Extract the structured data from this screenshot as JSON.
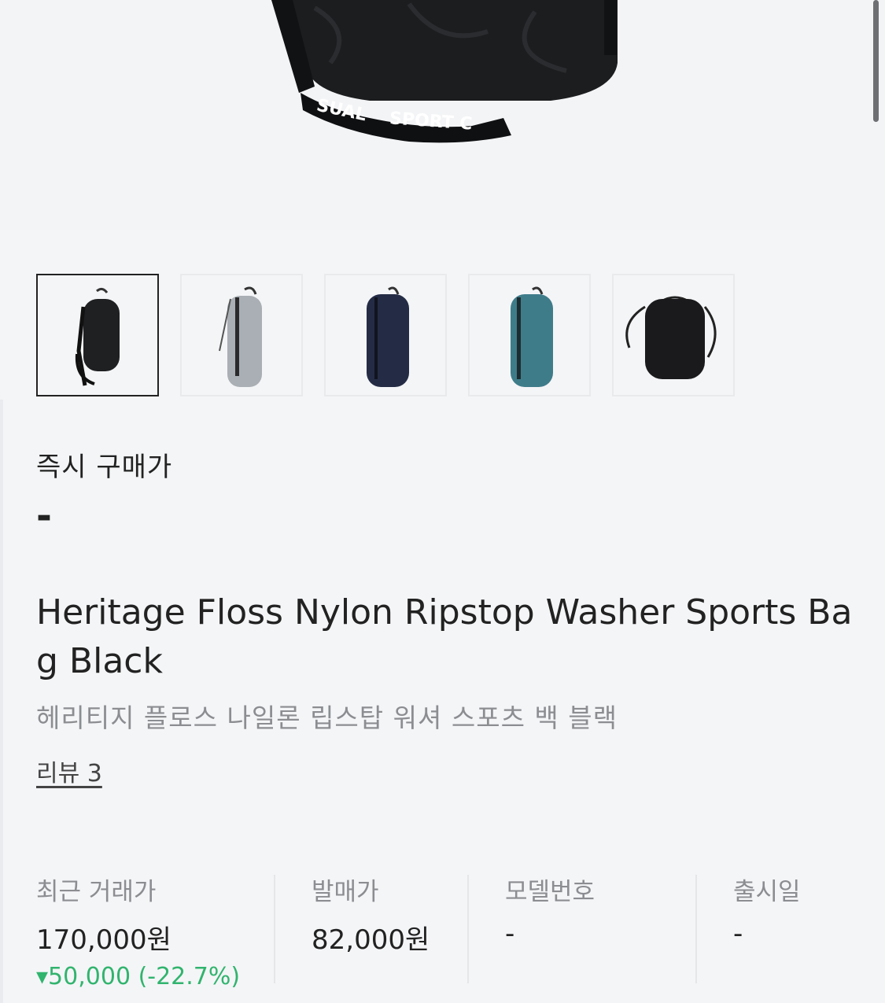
{
  "hero": {
    "image": "product-bag-black-closeup",
    "strap_text_left": "SUAL",
    "strap_text_right": "SPORT C"
  },
  "thumbnails": [
    {
      "color": "#1f2022",
      "selected": true,
      "name": "black"
    },
    {
      "color": "#a9afb4",
      "selected": false,
      "name": "gray"
    },
    {
      "color": "#242c45",
      "selected": false,
      "name": "navy"
    },
    {
      "color": "#3f7c8a",
      "selected": false,
      "name": "teal"
    },
    {
      "color": "#1a1a1c",
      "selected": false,
      "name": "black-alt"
    }
  ],
  "instant": {
    "label": "즉시 구매가",
    "price": "-"
  },
  "product": {
    "title_en": "Heritage Floss Nylon Ripstop Washer Sports Bag Black",
    "title_ko": "헤리티지 플로스 나일론 립스탑 워셔 스포츠 백 블랙",
    "review_link": "리뷰 3"
  },
  "stats": {
    "recent": {
      "label": "최근 거래가",
      "value": "170,000원",
      "change": "▾50,000 (-22.7%)"
    },
    "release_price": {
      "label": "발매가",
      "value": "82,000원"
    },
    "model": {
      "label": "모델번호",
      "value": "-"
    },
    "release_date": {
      "label": "출시일",
      "value": "-"
    }
  },
  "colors": {
    "accent_down": "#31b46e",
    "text_primary": "#222222",
    "text_muted": "#8b8d91"
  }
}
